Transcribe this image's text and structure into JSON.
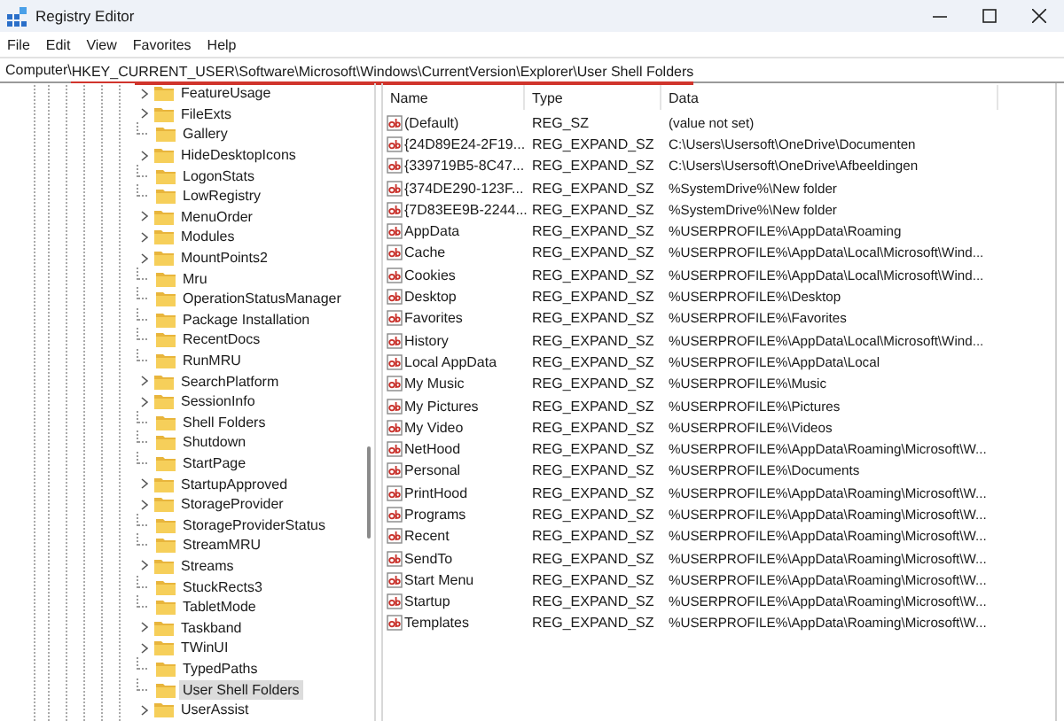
{
  "window": {
    "title": "Registry Editor"
  },
  "menu": [
    "File",
    "Edit",
    "View",
    "Favorites",
    "Help"
  ],
  "address_bar": {
    "segments": [
      {
        "text": "Computer\\",
        "underlined": false
      },
      {
        "text": "HKEY_CURRENT_USER\\Software\\Microsoft\\Windows\\CurrentVersion\\Explorer\\User Shell Folders",
        "underlined": true
      }
    ]
  },
  "tree": {
    "items": [
      {
        "label": "FeatureUsage",
        "expandable": true,
        "selected": false
      },
      {
        "label": "FileExts",
        "expandable": true,
        "selected": false
      },
      {
        "label": "Gallery",
        "expandable": false,
        "selected": false
      },
      {
        "label": "HideDesktopIcons",
        "expandable": true,
        "selected": false
      },
      {
        "label": "LogonStats",
        "expandable": false,
        "selected": false
      },
      {
        "label": "LowRegistry",
        "expandable": false,
        "selected": false
      },
      {
        "label": "MenuOrder",
        "expandable": true,
        "selected": false
      },
      {
        "label": "Modules",
        "expandable": true,
        "selected": false
      },
      {
        "label": "MountPoints2",
        "expandable": true,
        "selected": false
      },
      {
        "label": "Mru",
        "expandable": false,
        "selected": false
      },
      {
        "label": "OperationStatusManager",
        "expandable": false,
        "selected": false
      },
      {
        "label": "Package Installation",
        "expandable": false,
        "selected": false
      },
      {
        "label": "RecentDocs",
        "expandable": false,
        "selected": false
      },
      {
        "label": "RunMRU",
        "expandable": false,
        "selected": false
      },
      {
        "label": "SearchPlatform",
        "expandable": true,
        "selected": false
      },
      {
        "label": "SessionInfo",
        "expandable": true,
        "selected": false
      },
      {
        "label": "Shell Folders",
        "expandable": false,
        "selected": false
      },
      {
        "label": "Shutdown",
        "expandable": false,
        "selected": false
      },
      {
        "label": "StartPage",
        "expandable": false,
        "selected": false
      },
      {
        "label": "StartupApproved",
        "expandable": true,
        "selected": false
      },
      {
        "label": "StorageProvider",
        "expandable": true,
        "selected": false
      },
      {
        "label": "StorageProviderStatus",
        "expandable": false,
        "selected": false
      },
      {
        "label": "StreamMRU",
        "expandable": false,
        "selected": false
      },
      {
        "label": "Streams",
        "expandable": true,
        "selected": false
      },
      {
        "label": "StuckRects3",
        "expandable": false,
        "selected": false
      },
      {
        "label": "TabletMode",
        "expandable": false,
        "selected": false
      },
      {
        "label": "Taskband",
        "expandable": true,
        "selected": false
      },
      {
        "label": "TWinUI",
        "expandable": true,
        "selected": false
      },
      {
        "label": "TypedPaths",
        "expandable": false,
        "selected": false
      },
      {
        "label": "User Shell Folders",
        "expandable": false,
        "selected": true
      },
      {
        "label": "UserAssist",
        "expandable": true,
        "selected": false
      }
    ]
  },
  "table": {
    "columns": [
      "Name",
      "Type",
      "Data"
    ],
    "rows": [
      [
        "(Default)",
        "REG_SZ",
        "(value not set)"
      ],
      [
        "{24D89E24-2F19...",
        "REG_EXPAND_SZ",
        "C:\\Users\\Usersoft\\OneDrive\\Documenten"
      ],
      [
        "{339719B5-8C47...",
        "REG_EXPAND_SZ",
        "C:\\Users\\Usersoft\\OneDrive\\Afbeeldingen"
      ],
      [
        "{374DE290-123F...",
        "REG_EXPAND_SZ",
        "%SystemDrive%\\New folder"
      ],
      [
        "{7D83EE9B-2244...",
        "REG_EXPAND_SZ",
        "%SystemDrive%\\New folder"
      ],
      [
        "AppData",
        "REG_EXPAND_SZ",
        "%USERPROFILE%\\AppData\\Roaming"
      ],
      [
        "Cache",
        "REG_EXPAND_SZ",
        "%USERPROFILE%\\AppData\\Local\\Microsoft\\Wind..."
      ],
      [
        "Cookies",
        "REG_EXPAND_SZ",
        "%USERPROFILE%\\AppData\\Local\\Microsoft\\Wind..."
      ],
      [
        "Desktop",
        "REG_EXPAND_SZ",
        "%USERPROFILE%\\Desktop"
      ],
      [
        "Favorites",
        "REG_EXPAND_SZ",
        "%USERPROFILE%\\Favorites"
      ],
      [
        "History",
        "REG_EXPAND_SZ",
        "%USERPROFILE%\\AppData\\Local\\Microsoft\\Wind..."
      ],
      [
        "Local AppData",
        "REG_EXPAND_SZ",
        "%USERPROFILE%\\AppData\\Local"
      ],
      [
        "My Music",
        "REG_EXPAND_SZ",
        "%USERPROFILE%\\Music"
      ],
      [
        "My Pictures",
        "REG_EXPAND_SZ",
        "%USERPROFILE%\\Pictures"
      ],
      [
        "My Video",
        "REG_EXPAND_SZ",
        "%USERPROFILE%\\Videos"
      ],
      [
        "NetHood",
        "REG_EXPAND_SZ",
        "%USERPROFILE%\\AppData\\Roaming\\Microsoft\\W..."
      ],
      [
        "Personal",
        "REG_EXPAND_SZ",
        "%USERPROFILE%\\Documents"
      ],
      [
        "PrintHood",
        "REG_EXPAND_SZ",
        "%USERPROFILE%\\AppData\\Roaming\\Microsoft\\W..."
      ],
      [
        "Programs",
        "REG_EXPAND_SZ",
        "%USERPROFILE%\\AppData\\Roaming\\Microsoft\\W..."
      ],
      [
        "Recent",
        "REG_EXPAND_SZ",
        "%USERPROFILE%\\AppData\\Roaming\\Microsoft\\W..."
      ],
      [
        "SendTo",
        "REG_EXPAND_SZ",
        "%USERPROFILE%\\AppData\\Roaming\\Microsoft\\W..."
      ],
      [
        "Start Menu",
        "REG_EXPAND_SZ",
        "%USERPROFILE%\\AppData\\Roaming\\Microsoft\\W..."
      ],
      [
        "Startup",
        "REG_EXPAND_SZ",
        "%USERPROFILE%\\AppData\\Roaming\\Microsoft\\W..."
      ],
      [
        "Templates",
        "REG_EXPAND_SZ",
        "%USERPROFILE%\\AppData\\Roaming\\Microsoft\\W..."
      ]
    ]
  }
}
